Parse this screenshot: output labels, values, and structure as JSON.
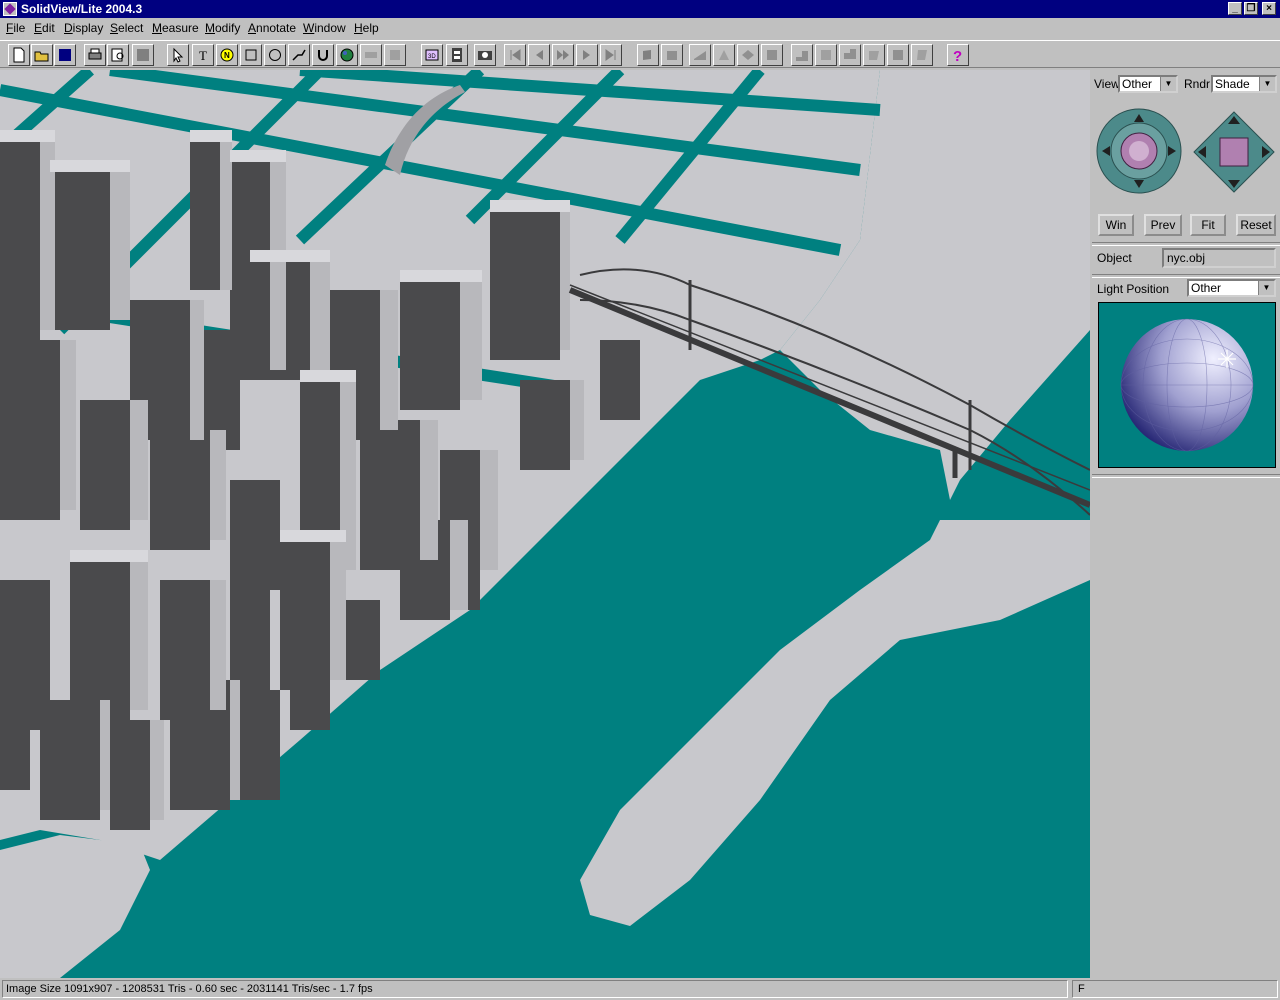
{
  "window": {
    "title": "SolidView/Lite 2004.3"
  },
  "menu": [
    "File",
    "Edit",
    "Display",
    "Select",
    "Measure",
    "Modify",
    "Annotate",
    "Window",
    "Help"
  ],
  "toolbar": {
    "buttons": [
      "new-file",
      "open-file",
      "save",
      "print",
      "print-preview",
      "blank",
      "select-arrow",
      "text-tool",
      "note-tool",
      "rectangle-tool",
      "ellipse-tool",
      "line-tool",
      "arc-tool",
      "globe",
      "blank-1",
      "blank-2",
      "view-3d",
      "film",
      "camera",
      "first-frame",
      "prev-frame",
      "play",
      "next-frame",
      "last-frame",
      "shade-1",
      "shade-2",
      "shade-3",
      "shade-4",
      "shade-5",
      "shade-6",
      "shade-7",
      "shade-8",
      "shade-9",
      "shade-10",
      "shade-11",
      "shade-12",
      "help"
    ]
  },
  "panel": {
    "view_label": "View",
    "view_value": "Other",
    "rndr_label": "Rndr",
    "rndr_value": "Shade",
    "buttons": {
      "win": "Win",
      "prev": "Prev",
      "fit": "Fit",
      "reset": "Reset"
    },
    "object_label": "Object",
    "object_value": "nyc.obj",
    "light_label": "Light Position",
    "light_value": "Other"
  },
  "status": {
    "main": "Image Size 1091x907 - 1208531 Tris -  0.60 sec - 2031141 Tris/sec -  1.7 fps",
    "flag": "F"
  },
  "colors": {
    "water": "#008080",
    "land": "#c8c8cc",
    "building_dark": "#4a4a4c",
    "title_bar": "#000080"
  }
}
